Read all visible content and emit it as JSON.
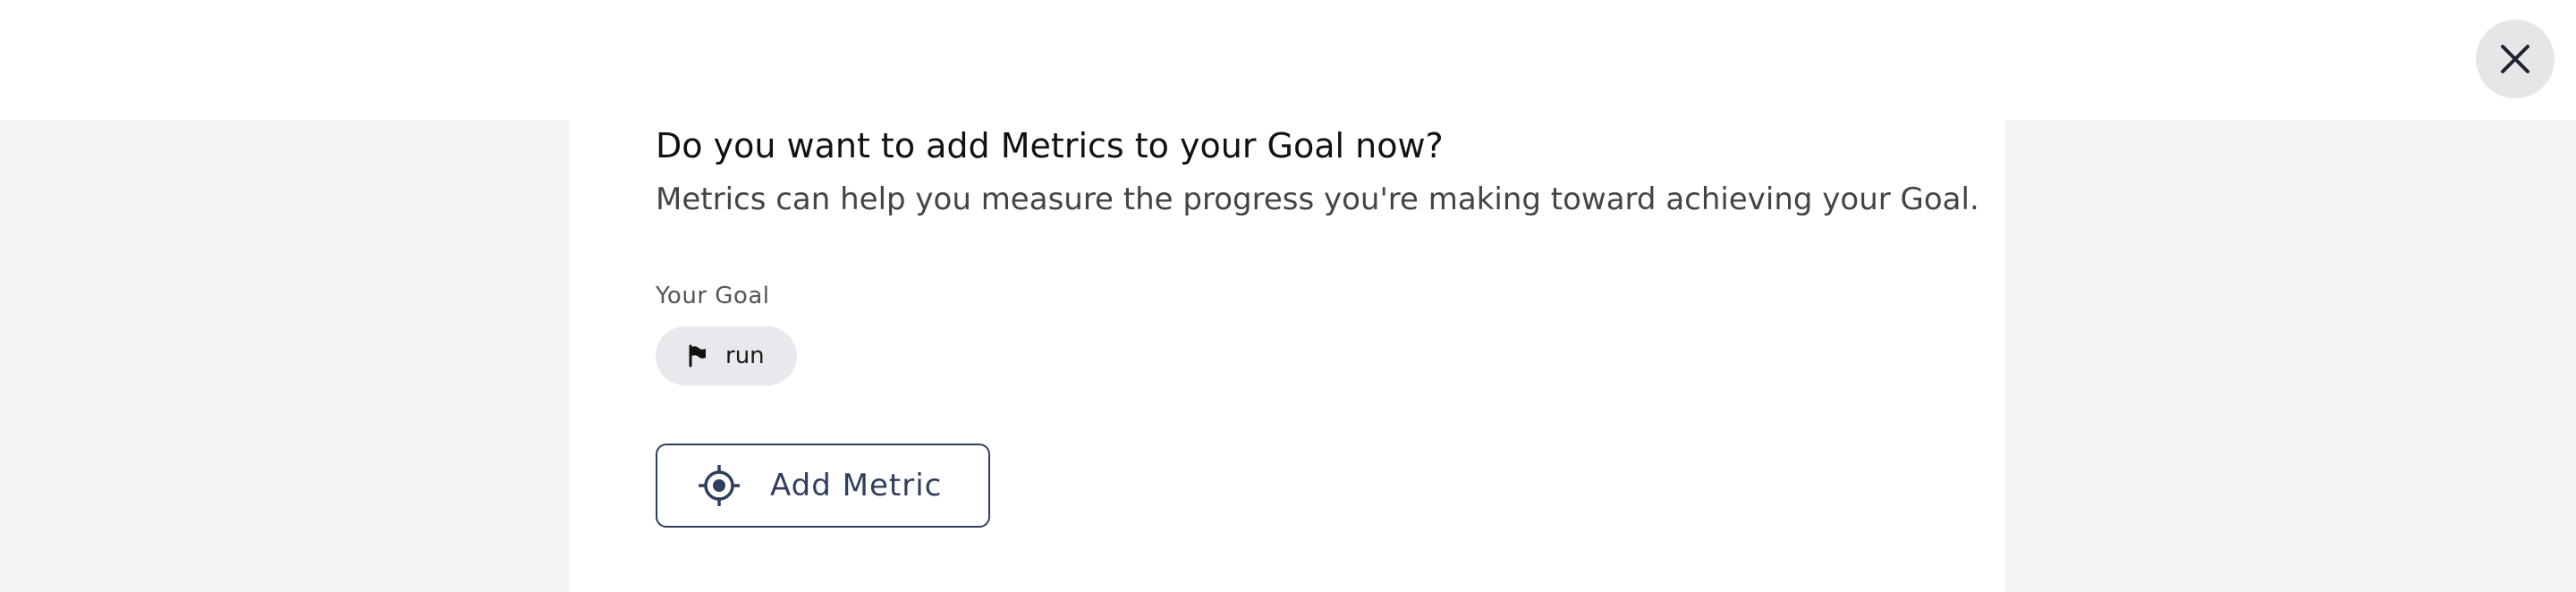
{
  "header": {
    "close_icon": "close-icon"
  },
  "dialog": {
    "title": "Do you want to add Metrics to your Goal now?",
    "subtitle": "Metrics can help you measure the progress you're making toward achieving your Goal.",
    "goal_section": {
      "label": "Your Goal",
      "goal_name": "run",
      "goal_icon": "flag-icon"
    },
    "add_metric_button": {
      "label": "Add Metric",
      "icon": "target-icon"
    }
  },
  "colors": {
    "backdrop": "#f4f4f4",
    "panel": "#ffffff",
    "chip_bg": "#e8e9ec",
    "accent": "#2f3f5e",
    "close_bg": "#e6e6e8"
  }
}
